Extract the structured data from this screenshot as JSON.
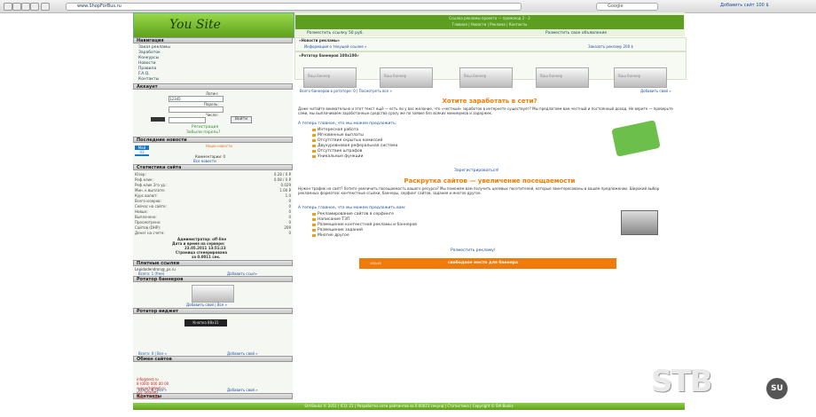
{
  "browser": {
    "address": "www.ShopForBus.ru",
    "search_placeholder": "Google",
    "bookmark": "Добавить сайт 100 $"
  },
  "header": {
    "logo_text": "You Site",
    "top_line": "Ссылка рекламы проекта — промокод 2 - 2",
    "sub_line": "Главная | Новости | Реклама | Контакты",
    "left_link": "Разместить ссылку 50 руб.",
    "right_link": "Разместить свое объявление"
  },
  "sidebar": {
    "nav_title": "Навигация",
    "nav_items": [
      "Заказ рекламы",
      "Заработок",
      "Конкурсы",
      "Новости",
      "Правила",
      "F.A.Q.",
      "Контакты"
    ],
    "account_title": "Аккаунт",
    "login_label": "Логин:",
    "login_value": "12345",
    "password_label": "Пароль:",
    "captcha_label": "Число:",
    "login_button": "Войти",
    "register_link": "Регистрация",
    "forgot_link": "Забыли пароль?",
    "news_title": "Последние новости",
    "news_date": "Май",
    "news_day": "03",
    "news_text": "Наши новости",
    "news_comments": "Комментарии: 0",
    "news_all": "Все новости",
    "stats_title": "Статистика сайта",
    "stats": [
      [
        "Юзер:",
        "0.28 / 0 ₽"
      ],
      [
        "Реф.клик:",
        "0.08 / 0 ₽"
      ],
      [
        "Реф.клик 2го ур.:",
        "0.029"
      ],
      [
        "Мин. к выплате:",
        "1.00 ₽"
      ],
      [
        "Курс валют:",
        "1.0"
      ],
      [
        "Всего юзеров:",
        "0"
      ],
      [
        "Сейчас на сайте:",
        "0"
      ],
      [
        "Новых:",
        "0"
      ],
      [
        "Выплачено:",
        "0"
      ],
      [
        "Просмотрено:",
        "0"
      ],
      [
        "Сайтов (DHP):",
        "209"
      ],
      [
        "Денег на счете:",
        "0"
      ]
    ],
    "stats_bold": "Администратор: off-line",
    "stats_date": "Дата и время на сервере:",
    "stats_time": "23.05.2011 13:51:23",
    "stats_gen": "Страница сгенерирована",
    "stats_gen2": "за 0.0011 сек.",
    "links_title": "Платные ссылки",
    "links_item": "Lepidodendron@_ps.ru",
    "links_all": "Всего: 1 (free)",
    "links_add": "Добавить ссыл»",
    "rot_title": "Ротатор баннеров",
    "rot_add": "Добавить свой | Все »",
    "widget_title": "Ротатор виджет",
    "widget_btn": "Кнопка 88x31",
    "footer_left": "Всего: 0 | Все »",
    "footer_right": "Добавить свой »",
    "surf_title": "Обмен сайтов",
    "surf_left": "Всего: 0 | Все »",
    "surf_right": "Добавить свой »",
    "contacts_title": "Контакты",
    "contacts": [
      "info@test.ru",
      "8 (000) 000 00 00",
      "support@test.ru",
      "icq: 000000",
      "Web. -> сайт"
    ]
  },
  "main": {
    "adv_title": "«Новости рекламы»",
    "adv_link": "Информация о текущей ссылке »",
    "adv_right": "Заказать рекламу 200 $",
    "rotator_title": "«Ротатор баннеров 100x100»",
    "banner_text": "Ваш баннер",
    "rot_total": "Всего баннеров в ротаторе: 0 | Посмотреть все »",
    "rot_add": "Добавить свой »",
    "earn_title": "Хотите заработать в сети?",
    "earn_text": "Даже читайте внимательно и этот текст ещё — есть ли у вас желание, что «честный» заработок в интернете существует? Мы предлагаем вам честный и постоянный доход. Не верите — проверьте сами, мы выплачиваем заработанные средства сразу же по заявке без всяких минимумов и задержек.",
    "earn_offer": "А теперь главное, что мы можем предложить:",
    "earn_items": [
      "Интересная работа",
      "Мгновенные выплаты",
      "Отсутствие скрытых комиссий",
      "Двухуровневая реферальная система",
      "Отсутствие штрафов",
      "Уникальные функции"
    ],
    "earn_register": "Зарегистрироваться!",
    "promo_title": "Раскрутка сайтов — увеличение посещаемости",
    "promo_text": "Нужен трафик на сайт? Хотите увеличить посещаемость вашего ресурса? Мы поможем вам получить целевых посетителей, которые заинтересованы в вашем предложении. Широкий выбор рекламных форматов: контекстные ссылки, баннеры, серфинг сайтов, задания и многое другое.",
    "promo_offer": "А теперь главное, что мы можем предложить вам:",
    "promo_items": [
      "Рекламирование сайтов в серфинге",
      "Написание ТЗП",
      "Размещение контекстной рекламы и баннеров",
      "Размещение заданий",
      "Многие другое"
    ],
    "promo_link": "Разместить рекламу!",
    "orange_text": "свободное место для баннера",
    "orange_left": "468x60"
  },
  "footer": {
    "text": "SVI-Books © 2011 | ICQ: 21 | Разработка сети рейтингов за 0.00023 секунд | Статистика | Copyright © SVI-Books"
  },
  "watermark": {
    "text": "STB",
    "badge": "SU"
  }
}
